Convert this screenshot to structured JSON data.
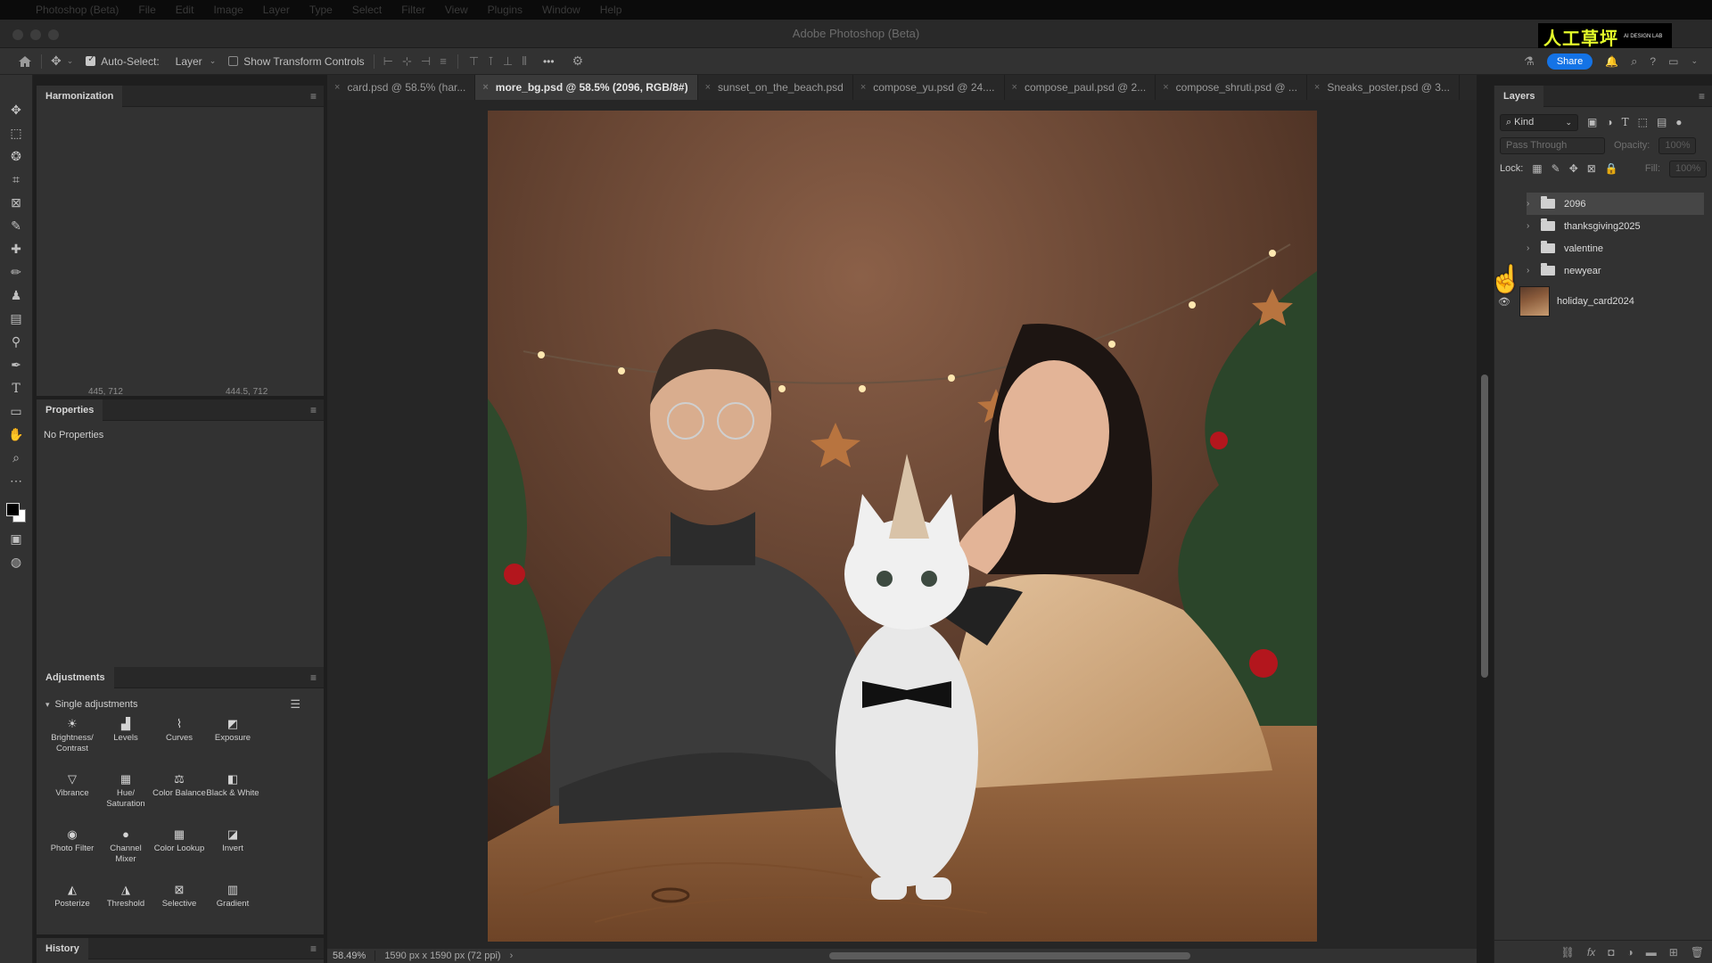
{
  "menubar": {
    "items": [
      "Photoshop (Beta)",
      "File",
      "Edit",
      "Image",
      "Layer",
      "Type",
      "Select",
      "Filter",
      "View",
      "Plugins",
      "Window",
      "Help"
    ]
  },
  "window": {
    "title": "Adobe Photoshop (Beta)"
  },
  "options_bar": {
    "auto_select_label": "Auto-Select:",
    "auto_select_value": "Layer",
    "show_transform_label": "Show Transform Controls",
    "more_label": "•••",
    "share_label": "Share"
  },
  "logo": {
    "main": "人工草坪",
    "sub": "AI DESIGN LAB"
  },
  "panels": {
    "harmonization": {
      "title": "Harmonization",
      "coord_left": "445, 712",
      "coord_right": "444.5, 712"
    },
    "properties": {
      "title": "Properties",
      "empty_text": "No Properties"
    },
    "adjustments": {
      "title": "Adjustments",
      "section": "Single adjustments",
      "items": [
        {
          "label": "Brightness/ Contrast",
          "icon": "brightness-icon"
        },
        {
          "label": "Levels",
          "icon": "levels-icon"
        },
        {
          "label": "Curves",
          "icon": "curves-icon"
        },
        {
          "label": "Exposure",
          "icon": "exposure-icon"
        },
        {
          "label": "Vibrance",
          "icon": "vibrance-icon"
        },
        {
          "label": "Hue/ Saturation",
          "icon": "hue-icon"
        },
        {
          "label": "Color Balance",
          "icon": "balance-icon"
        },
        {
          "label": "Black & White",
          "icon": "bw-icon"
        },
        {
          "label": "Photo Filter",
          "icon": "camera-icon"
        },
        {
          "label": "Channel Mixer",
          "icon": "mixer-icon"
        },
        {
          "label": "Color Lookup",
          "icon": "grid-icon"
        },
        {
          "label": "Invert",
          "icon": "invert-icon"
        },
        {
          "label": "Posterize",
          "icon": "posterize-icon"
        },
        {
          "label": "Threshold",
          "icon": "threshold-icon"
        },
        {
          "label": "Selective",
          "icon": "selective-icon"
        },
        {
          "label": "Gradient",
          "icon": "gradient-icon"
        }
      ]
    },
    "history": {
      "title": "History"
    }
  },
  "tabs": [
    {
      "label": "card.psd @ 58.5% (har...",
      "active": false
    },
    {
      "label": "more_bg.psd @ 58.5% (2096, RGB/8#)",
      "active": true
    },
    {
      "label": "sunset_on_the_beach.psd",
      "active": false
    },
    {
      "label": "compose_yu.psd @ 24....",
      "active": false
    },
    {
      "label": "compose_paul.psd @ 2...",
      "active": false
    },
    {
      "label": "compose_shruti.psd @ ...",
      "active": false
    },
    {
      "label": "Sneaks_poster.psd @ 3...",
      "active": false
    }
  ],
  "status": {
    "zoom": "58.49%",
    "doc_info": "1590 px x 1590 px (72 ppi)",
    "arrow": "›"
  },
  "layers_panel": {
    "title": "Layers",
    "filter": "Kind",
    "blend_mode": "Pass Through",
    "opacity_label": "Opacity:",
    "opacity_value": "100%",
    "lock_label": "Lock:",
    "fill_label": "Fill:",
    "fill_value": "100%",
    "layers": [
      {
        "name": "2096",
        "type": "group",
        "selected": true,
        "visible": false
      },
      {
        "name": "thanksgiving2025",
        "type": "group",
        "selected": false,
        "visible": false
      },
      {
        "name": "valentine",
        "type": "group",
        "selected": false,
        "visible": false
      },
      {
        "name": "newyear",
        "type": "group",
        "selected": false,
        "visible": false
      },
      {
        "name": "holiday_card2024",
        "type": "pixel",
        "selected": false,
        "visible": true
      }
    ]
  },
  "colors": {
    "accent": "#1473e6",
    "logo_yellow": "#e5ff2a",
    "panel_bg": "#323232",
    "canvas_bg": "#262626"
  }
}
